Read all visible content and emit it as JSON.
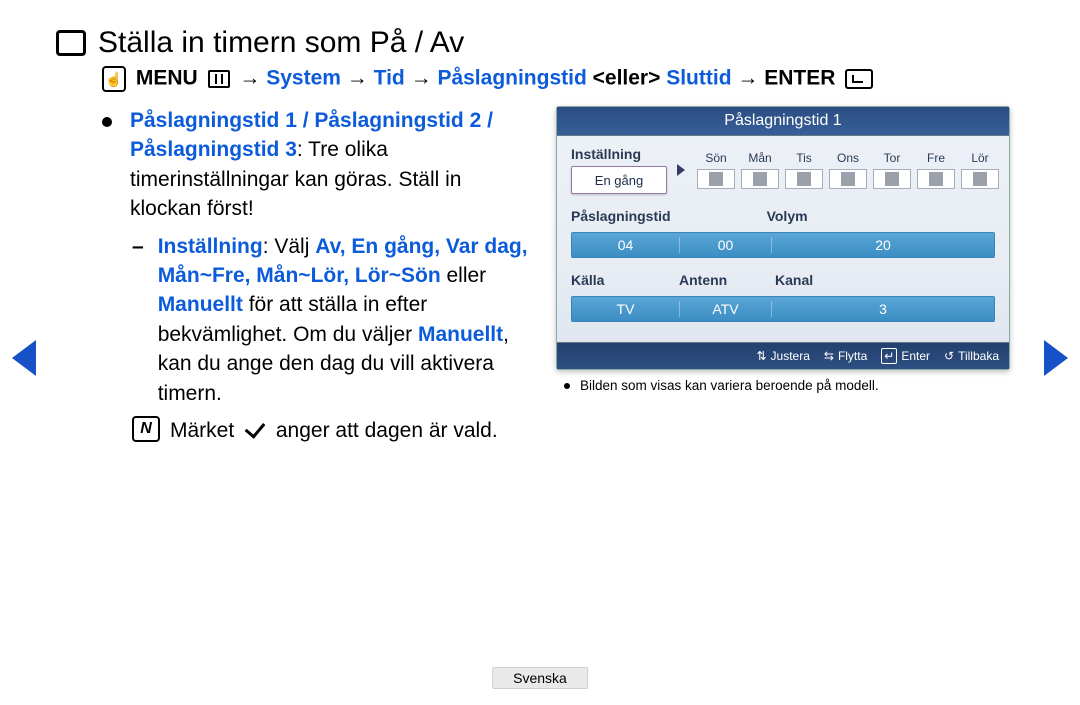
{
  "title": "Ställa in timern som På / Av",
  "breadcrumb": {
    "menu": "MENU",
    "arrow": "→",
    "system": "System",
    "tid": "Tid",
    "paslag": "Påslagningstid",
    "eller": "<eller>",
    "sluttid": "Sluttid",
    "enter": "ENTER"
  },
  "left": {
    "intro_blue": "Påslagningstid 1 / Påslagningstid 2 / Påslagningstid 3",
    "intro_rest_1": ": Tre olika timerinställningar kan göras. Ställ in klockan först!",
    "setting_label": "Inställning",
    "setting_after": ": Välj ",
    "setting_options": "Av, En gång, Var dag, Mån~Fre, Mån~Lör, Lör~Sön",
    "setting_or": " eller ",
    "manually": "Manuellt",
    "setting_tail": " för att ställa in efter bekvämlighet. Om du väljer ",
    "setting_tail2": ", kan du ange den dag du vill aktivera timern.",
    "note_a": "Märket",
    "note_b": "anger att dagen är vald."
  },
  "panel": {
    "title": "Påslagningstid 1",
    "setup_label": "Inställning",
    "dropdown_value": "En gång",
    "days": [
      "Sön",
      "Mån",
      "Tis",
      "Ons",
      "Tor",
      "Fre",
      "Lör"
    ],
    "paslag_label": "Påslagningstid",
    "volym_label": "Volym",
    "time_hh": "04",
    "time_mm": "00",
    "volume": "20",
    "kalla_label": "Källa",
    "antenn_label": "Antenn",
    "kanal_label": "Kanal",
    "kalla_val": "TV",
    "antenn_val": "ATV",
    "kanal_val": "3",
    "footer": {
      "justera": "Justera",
      "flytta": "Flytta",
      "enter": "Enter",
      "tillbaka": "Tillbaka"
    }
  },
  "caption": "Bilden som visas kan variera beroende på modell.",
  "lang": "Svenska"
}
